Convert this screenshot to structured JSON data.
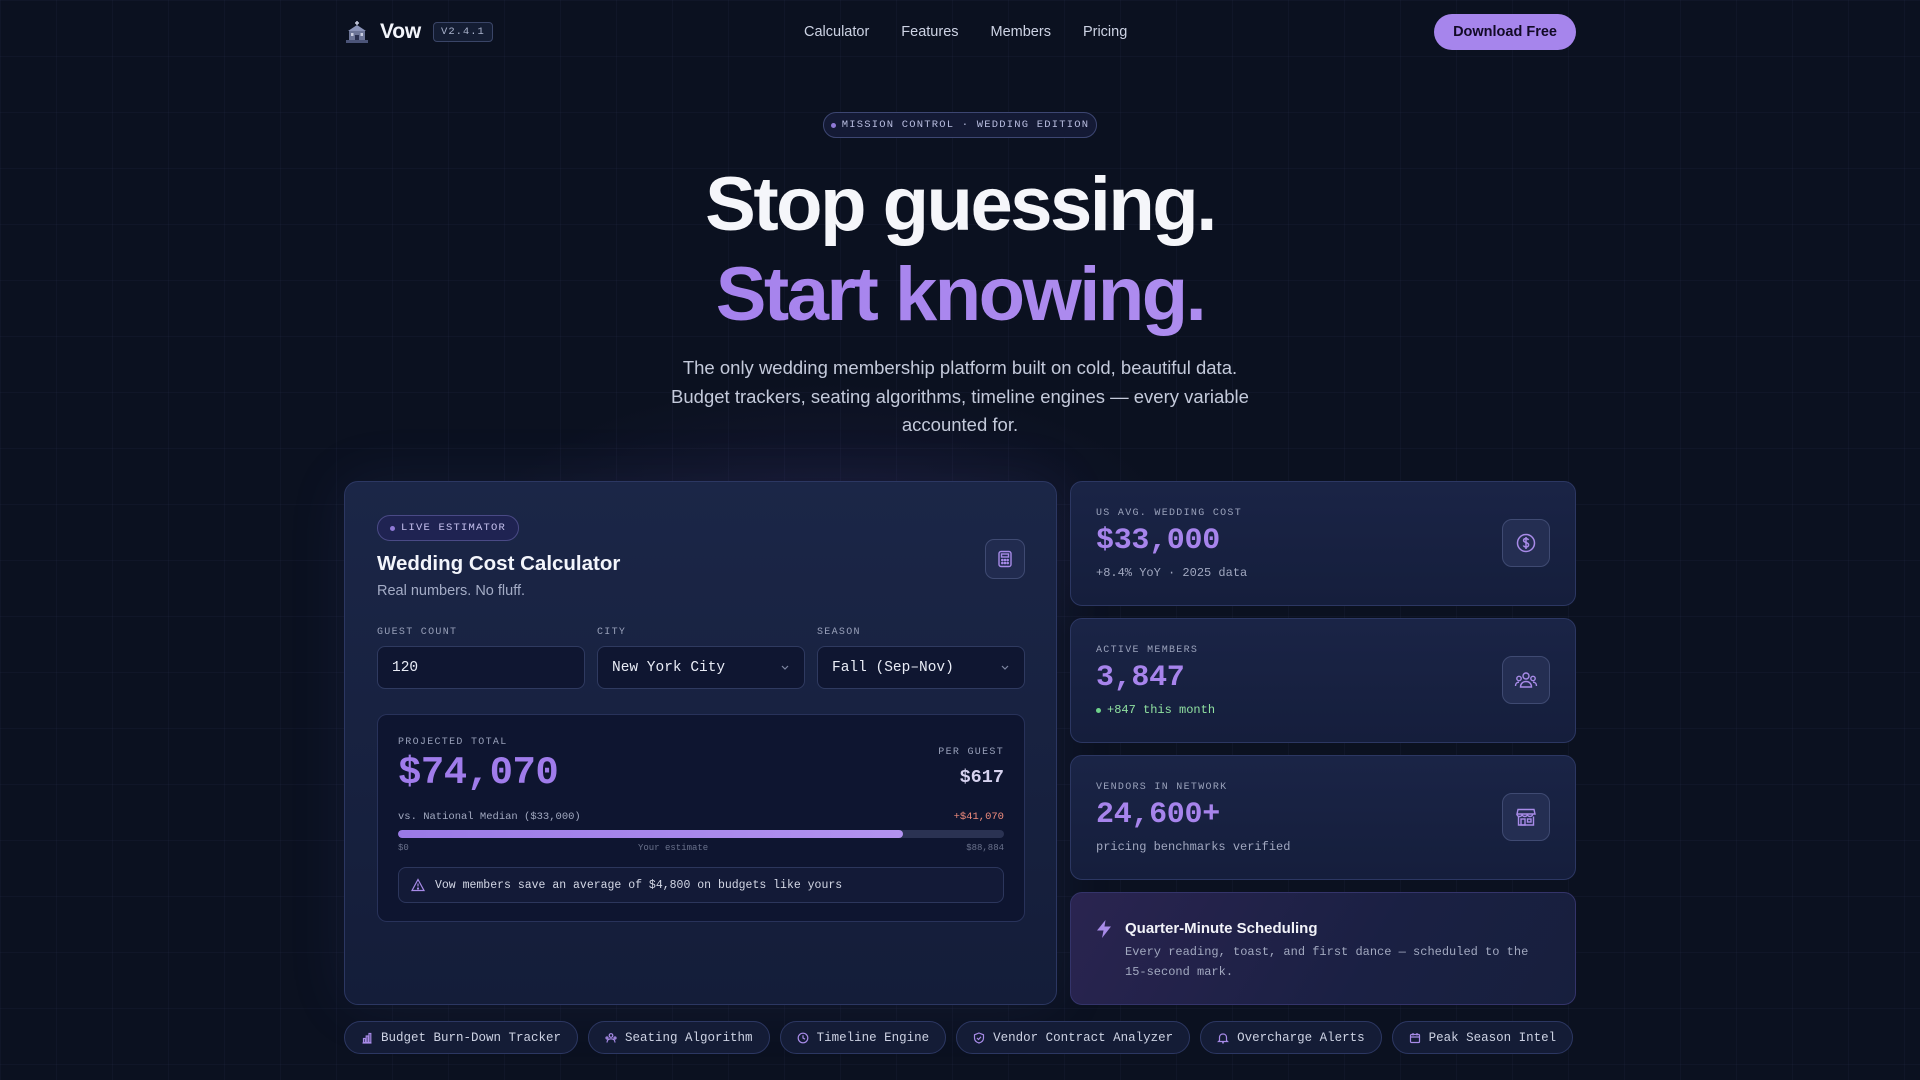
{
  "nav": {
    "brand": "Vow",
    "version": "V2.4.1",
    "links": [
      "Calculator",
      "Features",
      "Members",
      "Pricing"
    ],
    "cta": "Download Free"
  },
  "hero": {
    "badge": "MISSION CONTROL · WEDDING EDITION",
    "headline": "Stop guessing.",
    "headline_accent": "Start knowing.",
    "subtitle": "The only wedding membership platform built on cold, beautiful data. Budget trackers, seating algorithms, timeline engines — every variable accounted for."
  },
  "calculator": {
    "badge": "LIVE ESTIMATOR",
    "title": "Wedding Cost Calculator",
    "subtitle": "Real numbers. No fluff.",
    "fields": {
      "guest_count": {
        "label": "GUEST COUNT",
        "value": "120"
      },
      "city": {
        "label": "CITY",
        "value": "New York City"
      },
      "season": {
        "label": "SEASON",
        "value": "Fall (Sep–Nov)"
      }
    },
    "result": {
      "label": "PROJECTED TOTAL",
      "total": "$74,070",
      "per_guest_label": "PER GUEST",
      "per_guest": "$617",
      "comparison": "vs. National Median ($33,000)",
      "delta": "+$41,070",
      "progress": 0.833,
      "scale_min": "$0",
      "scale_mid": "Your estimate",
      "scale_max": "$88,884",
      "note": "Vow members save an average of $4,800 on budgets like yours"
    }
  },
  "stats": [
    {
      "label": "US AVG. WEDDING COST",
      "value": "$33,000",
      "sub": "+8.4% YoY · 2025 data",
      "icon": "dollar-icon"
    },
    {
      "label": "ACTIVE MEMBERS",
      "value": "3,847",
      "sub": "+847 this month",
      "icon": "users-icon"
    },
    {
      "label": "VENDORS IN NETWORK",
      "value": "24,600+",
      "sub": "pricing benchmarks verified",
      "icon": "storefront-icon"
    }
  ],
  "feature": {
    "title": "Quarter-Minute Scheduling",
    "description": "Every reading, toast, and first dance — scheduled to the 15-second mark.",
    "icon": "lightning-icon"
  },
  "chips": [
    {
      "label": "Budget Burn-Down Tracker",
      "icon": "bar-chart-icon"
    },
    {
      "label": "Seating Algorithm",
      "icon": "seating-icon"
    },
    {
      "label": "Timeline Engine",
      "icon": "clock-icon"
    },
    {
      "label": "Vendor Contract Analyzer",
      "icon": "shield-icon"
    },
    {
      "label": "Overcharge Alerts",
      "icon": "bell-icon"
    },
    {
      "label": "Peak Season Intel",
      "icon": "calendar-icon"
    }
  ],
  "colors": {
    "background": "#0b1120",
    "accent": "#a685ec",
    "card": "#1a2446",
    "positive": "#8fe0a0",
    "negative": "#f08c7d"
  }
}
